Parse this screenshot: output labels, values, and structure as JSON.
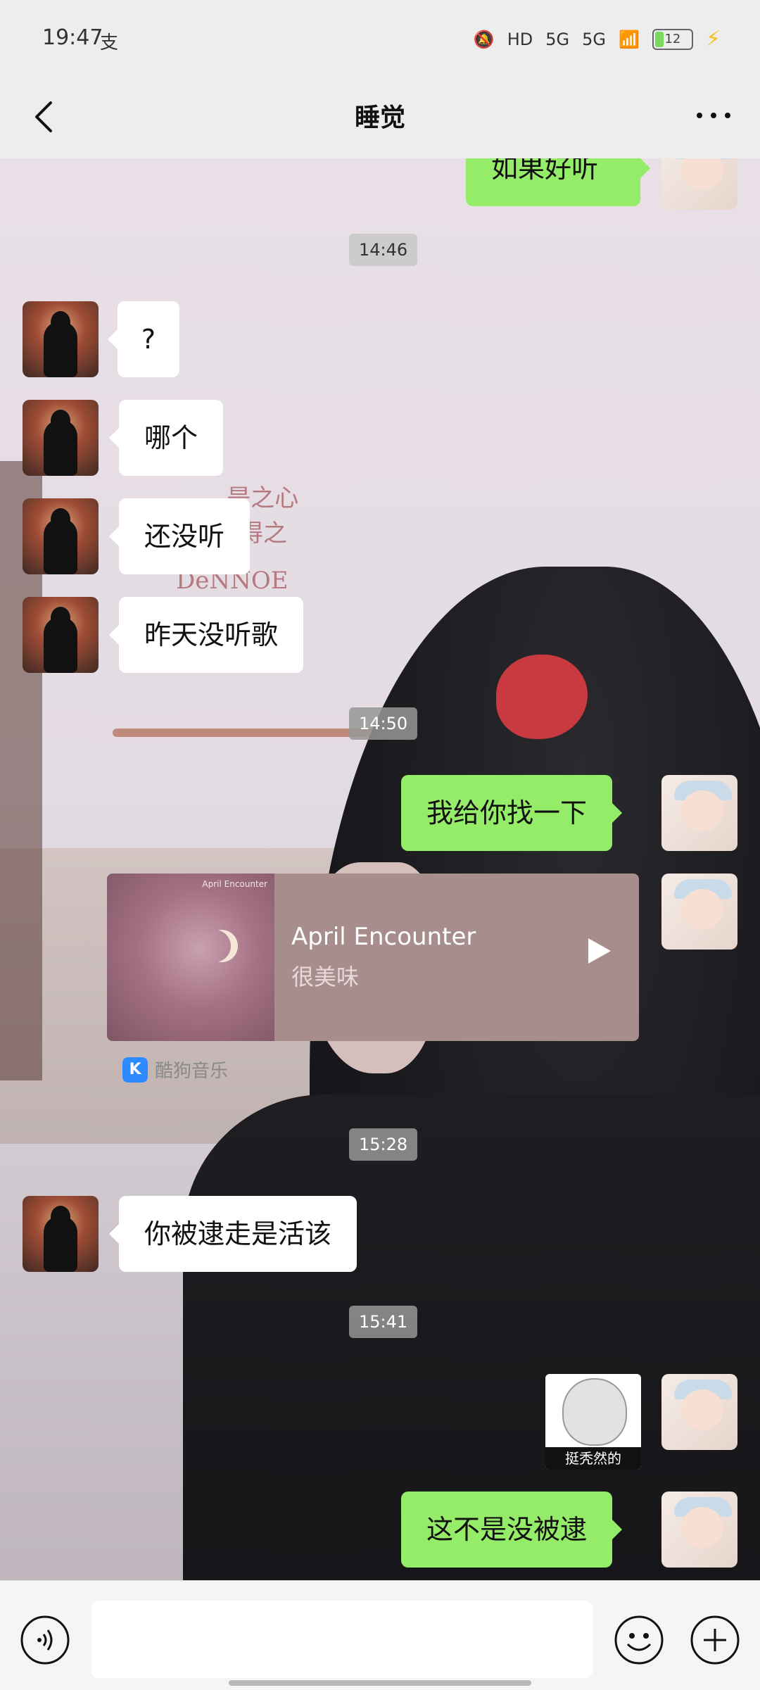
{
  "status_bar": {
    "time": "19:47",
    "extra": "支",
    "network": [
      "HD",
      "5G",
      "5G"
    ],
    "battery": "12"
  },
  "header": {
    "title": "睡觉"
  },
  "background": {
    "doodles": [
      "- 是之心",
      "得之",
      "DeNNOE"
    ]
  },
  "messages": {
    "top_partial": "如果好听",
    "ts1": "14:46",
    "m1": "?",
    "m2": "哪个",
    "m3": "还没听",
    "m4": "昨天没听歌",
    "ts2": "14:50",
    "m5": "我给你找一下",
    "music": {
      "cover_title": "April Encounter",
      "song": "April Encounter",
      "artist": "很美味",
      "source_badge": "K",
      "source": "酷狗音乐"
    },
    "ts3": "15:28",
    "m6": "你被逮走是活该",
    "ts4": "15:41",
    "sticker_caption": "挺秃然的",
    "m7": "这不是没被逮"
  },
  "input": {
    "value": "",
    "placeholder": ""
  }
}
